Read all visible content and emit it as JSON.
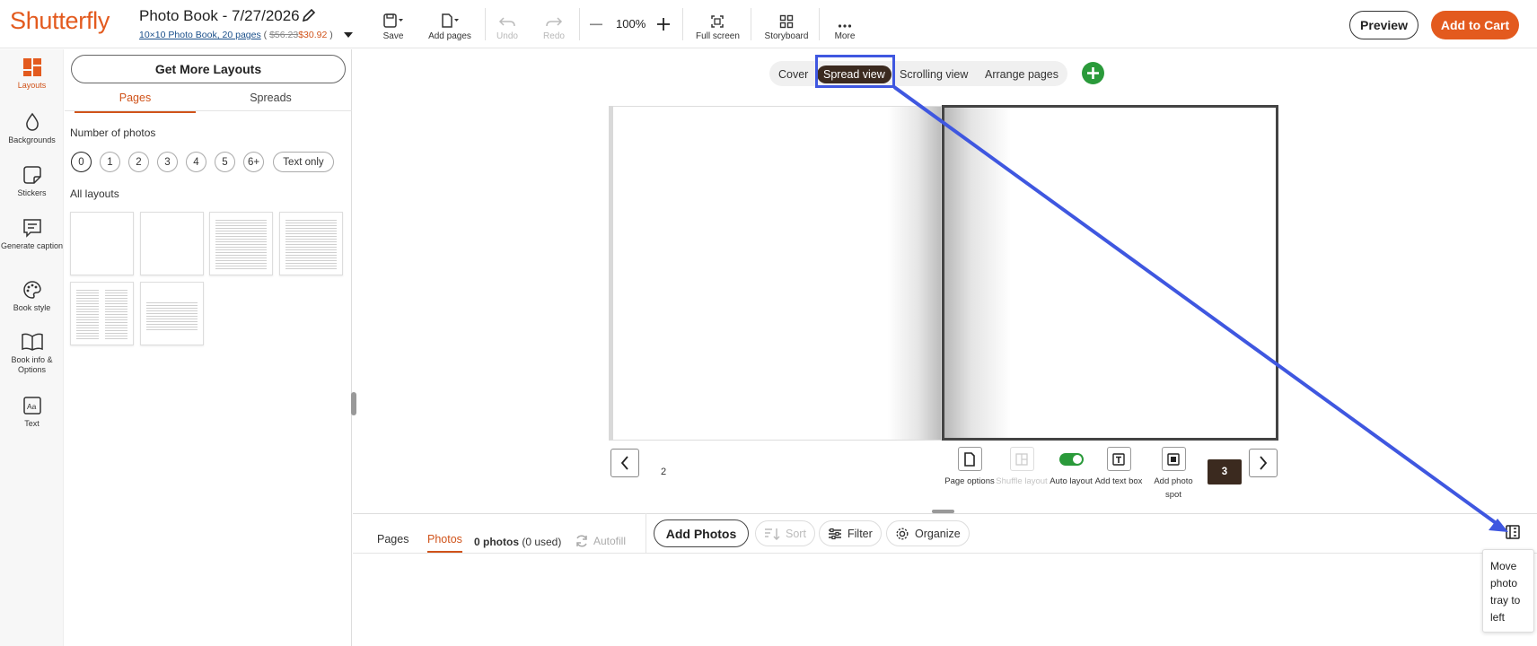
{
  "header": {
    "logo_text": "Shutterfly",
    "book_title": "Photo Book - 7/27/2026",
    "book_link": "10×10 Photo Book, 20 pages",
    "price_open": " ( ",
    "old_price": "$56.23",
    "new_price": "$30.92",
    "price_close": " )",
    "tools": {
      "save": "Save",
      "add_pages": "Add pages",
      "undo": "Undo",
      "redo": "Redo",
      "full_screen": "Full screen",
      "storyboard": "Storyboard",
      "more": "More"
    },
    "zoom": "100%",
    "preview_label": "Preview",
    "add_to_cart_label": "Add to Cart"
  },
  "rail": {
    "items": [
      {
        "label": "Layouts",
        "icon": "layouts-icon",
        "active": true
      },
      {
        "label": "Backgrounds",
        "icon": "drop-icon"
      },
      {
        "label": "Stickers",
        "icon": "sticker-icon"
      },
      {
        "label": "Generate caption",
        "icon": "caption-icon"
      },
      {
        "label": "Book style",
        "icon": "palette-icon"
      },
      {
        "label": "Book info & Options",
        "icon": "book-icon"
      },
      {
        "label": "Text",
        "icon": "text-icon"
      }
    ]
  },
  "panel": {
    "get_more_layouts": "Get More Layouts",
    "tabs": {
      "pages": "Pages",
      "spreads": "Spreads"
    },
    "number_of_photos_label": "Number of photos",
    "chips": [
      "0",
      "1",
      "2",
      "3",
      "4",
      "5",
      "6+"
    ],
    "text_only_label": "Text only",
    "all_layouts_label": "All layouts"
  },
  "canvas": {
    "view_tabs": {
      "cover": "Cover",
      "spread": "Spread view",
      "scrolling": "Scrolling view",
      "arrange": "Arrange pages"
    },
    "left_page_number": "2",
    "current_page_badge": "3",
    "page_tools": {
      "page_options": "Page options",
      "shuffle_layout": "Shuffle layout",
      "auto_layout": "Auto layout",
      "add_text_box": "Add text box",
      "add_photo_spot": "Add photo spot"
    }
  },
  "tray": {
    "tab_pages": "Pages",
    "tab_photos": "Photos",
    "count_bold": "0 photos",
    "count_rest": " (0 used)",
    "autofill": "Autofill",
    "add_photos": "Add Photos",
    "sort": "Sort",
    "filter": "Filter",
    "organize": "Organize",
    "tooltip": "Move photo tray to left"
  },
  "colors": {
    "brand_orange": "#e35a1e",
    "active_dark": "#3b2a1f",
    "toggle_green": "#2a9a3a",
    "annotation_blue": "#3f57e0"
  }
}
